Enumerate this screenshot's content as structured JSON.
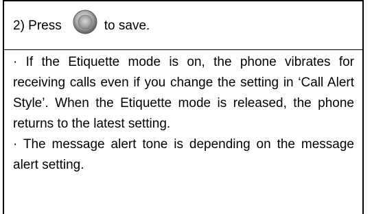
{
  "step": {
    "prefix": "2) Press",
    "button_icon": "round-gray-button-icon",
    "suffix": "to save."
  },
  "notes": [
    "· If the Etiquette mode is on, the phone vibrates for receiving calls even if you change the setting in ‘Call Alert Style’. When the Etiquette mode is released, the phone returns to the latest setting.",
    "· The message alert tone is depending on the message alert setting."
  ],
  "colors": {
    "border": "#000000",
    "text": "#000000",
    "icon_fill": "#9a9a9a"
  }
}
